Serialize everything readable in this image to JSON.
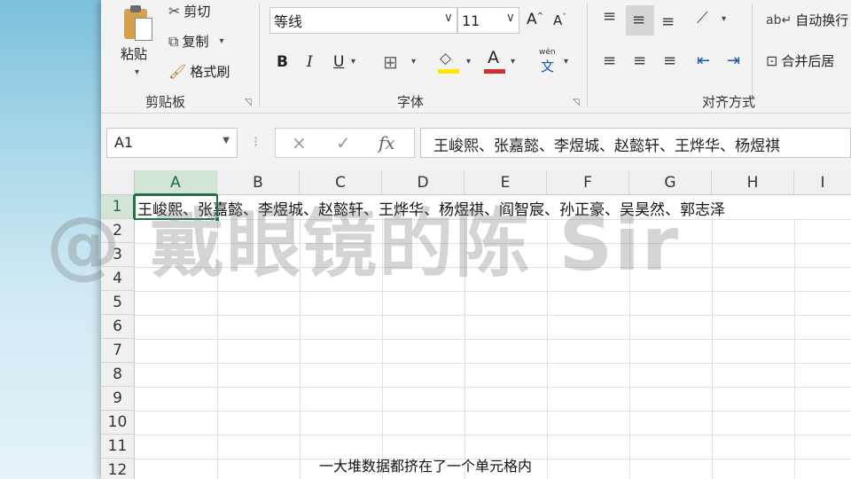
{
  "ribbon": {
    "clipboard": {
      "paste_label": "粘贴",
      "cut_label": "剪切",
      "copy_label": "复制",
      "format_painter_label": "格式刷",
      "group_label": "剪贴板"
    },
    "font": {
      "font_name": "等线",
      "font_size": "11",
      "bold": "B",
      "italic": "I",
      "underline": "U",
      "phonetic_top": "wén",
      "phonetic_char": "文",
      "font_color_letter": "A",
      "group_label": "字体"
    },
    "alignment": {
      "wrap_text_label": "自动换行",
      "merge_label": "合并后居",
      "group_label": "对齐方式"
    }
  },
  "formula_bar": {
    "name_box": "A1",
    "cancel_icon": "×",
    "enter_icon": "✓",
    "fx": "fx",
    "content": "王峻熙、张嘉懿、李煜城、赵懿轩、王烨华、杨煜祺"
  },
  "sheet": {
    "columns": [
      "A",
      "B",
      "C",
      "D",
      "E",
      "F",
      "G",
      "H",
      "I"
    ],
    "rows": [
      "1",
      "2",
      "3",
      "4",
      "5",
      "6",
      "7",
      "8",
      "9",
      "10",
      "11",
      "12"
    ],
    "a1_value": "王峻熙、张嘉懿、李煜城、赵懿轩、王烨华、杨煜祺、阎智宸、孙正豪、吴昊然、郭志泽",
    "active_cell": "A1"
  },
  "watermark": "@ 戴眼镜的陈 Sir",
  "subtitle": "一大堆数据都挤在了一个单元格内",
  "colors": {
    "excel_green": "#217346",
    "font_color_red": "#d32f2f",
    "highlight_yellow": "#ffe600"
  }
}
